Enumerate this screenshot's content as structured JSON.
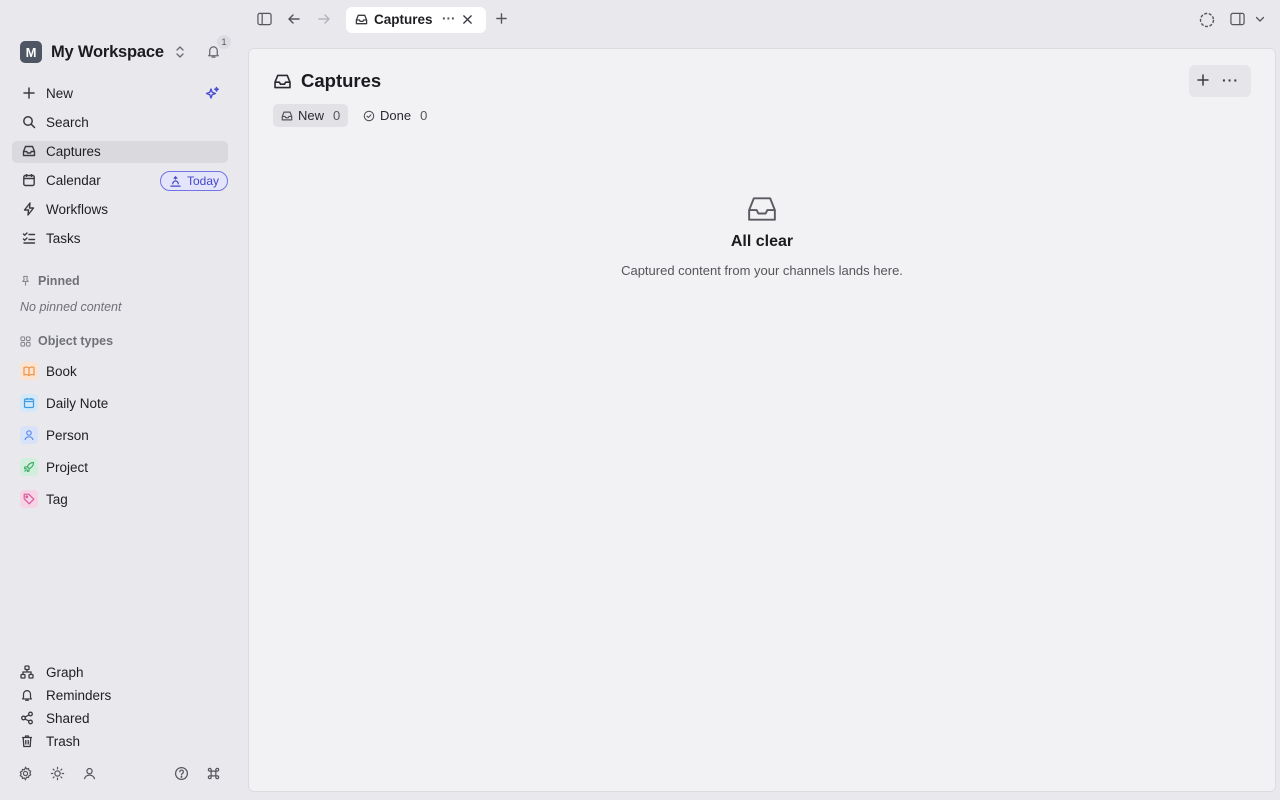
{
  "workspace": {
    "avatar_letter": "M",
    "name": "My Workspace",
    "notification_count": "1"
  },
  "sidebar": {
    "nav": [
      {
        "label": "New",
        "icon": "plus-icon"
      },
      {
        "label": "Search",
        "icon": "search-icon"
      },
      {
        "label": "Captures",
        "icon": "inbox-icon",
        "active": true
      },
      {
        "label": "Calendar",
        "icon": "calendar-icon",
        "badge": "Today"
      },
      {
        "label": "Workflows",
        "icon": "bolt-icon"
      },
      {
        "label": "Tasks",
        "icon": "checklist-icon"
      }
    ],
    "pinned": {
      "heading": "Pinned",
      "empty_text": "No pinned content"
    },
    "object_types": {
      "heading": "Object types",
      "items": [
        {
          "label": "Book",
          "icon": "book-icon",
          "color": "#e8944a"
        },
        {
          "label": "Daily Note",
          "icon": "calendar-icon",
          "color": "#3d9be0"
        },
        {
          "label": "Person",
          "icon": "person-icon",
          "color": "#5c8de8"
        },
        {
          "label": "Project",
          "icon": "rocket-icon",
          "color": "#3fae6a"
        },
        {
          "label": "Tag",
          "icon": "tag-icon",
          "color": "#d65a9a"
        }
      ]
    },
    "bottom_nav": [
      {
        "label": "Graph",
        "icon": "graph-icon"
      },
      {
        "label": "Reminders",
        "icon": "bell-icon"
      },
      {
        "label": "Shared",
        "icon": "share-icon"
      },
      {
        "label": "Trash",
        "icon": "trash-icon"
      }
    ],
    "footer_icons": [
      "gear-icon",
      "sun-icon",
      "person-icon",
      "help-icon",
      "command-icon"
    ]
  },
  "topbar": {
    "tab": {
      "label": "Captures",
      "icon": "inbox-icon"
    }
  },
  "main": {
    "title": "Captures",
    "filters": [
      {
        "label": "New",
        "count": "0",
        "selected": true
      },
      {
        "label": "Done",
        "count": "0",
        "selected": false
      }
    ],
    "empty_state": {
      "title": "All clear",
      "subtitle": "Captured content from your channels lands here."
    }
  },
  "colors": {
    "accent": "#4b4fd6",
    "sidebar_bg": "#e9e9ed",
    "panel_bg": "#f2f2f4"
  }
}
